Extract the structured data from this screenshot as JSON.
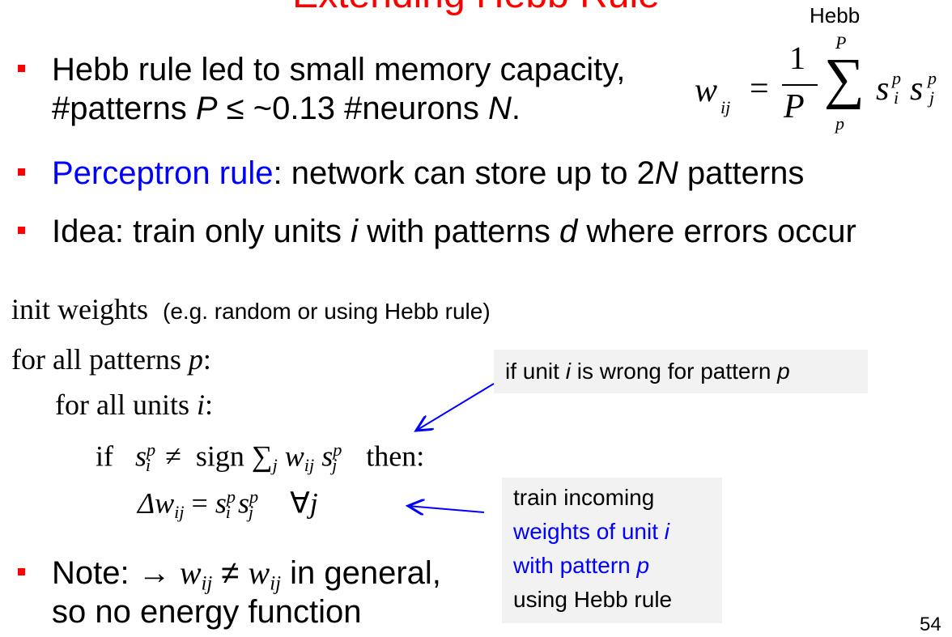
{
  "slide": {
    "title": "Extending Hebb Rule",
    "page_number": "54"
  },
  "hebb_formula": {
    "label": "Hebb",
    "lhs": "w",
    "lhs_sub": "ij",
    "equals": "=",
    "numerator": "1",
    "denominator": "P",
    "sum_upper": "P",
    "sum_lower": "p",
    "term1": "s",
    "term1_sup": "p",
    "term1_sub": "i",
    "term2": "s",
    "term2_sup": "p",
    "term2_sub": "j"
  },
  "bullets": {
    "b1_line1": "Hebb rule led to small memory capacity,",
    "b1_line2_a": "#patterns ",
    "b1_line2_P": "P",
    "b1_line2_b": " ≤ ~0.13 #neurons ",
    "b1_line2_N": "N",
    "b1_line2_c": ".",
    "b2_link": "Perceptron rule",
    "b2_a": ": network can store up to 2",
    "b2_N": "N",
    "b2_b": " patterns",
    "b3_a": "Idea: train only units ",
    "b3_i": "i",
    "b3_b": " with patterns ",
    "b3_d": "d",
    "b3_c": " where errors occur",
    "b4_a": "Note: → ",
    "b4_w1": "w",
    "b4_w1_sub": "ij",
    "b4_neq": " ≠ ",
    "b4_w2": "w",
    "b4_w2_sub": "ij",
    "b4_b": " in general,",
    "b4_line2": "so no energy function"
  },
  "algorithm": {
    "line1": "init weights",
    "line1_note": "(e.g. random or using Hebb rule)",
    "line2_a": "for all patterns ",
    "line2_p": "p",
    "line2_b": ":",
    "line3_a": "for all units ",
    "line3_i": "i",
    "line3_b": ":",
    "line4_if": "if",
    "line4_s": "s",
    "line4_s_sup": "p",
    "line4_s_sub": "i",
    "line4_neq": "≠",
    "line4_sign": "sign",
    "line4_sum": "∑",
    "line4_sum_sub": "j",
    "line4_w": "w",
    "line4_w_sub": "ij",
    "line4_s2": "s",
    "line4_s2_sup": "p",
    "line4_s2_sub": "j",
    "line4_then": "then:",
    "line5_delta": "Δw",
    "line5_sub": "ij",
    "line5_eq": "=",
    "line5_s1": "s",
    "line5_s1_sup": "p",
    "line5_s1_sub": "i",
    "line5_s2": "s",
    "line5_s2_sup": "p",
    "line5_s2_sub": "j",
    "line5_forall": "∀",
    "line5_j": "j"
  },
  "callouts": {
    "wrong_a": "if unit ",
    "wrong_i": "i",
    "wrong_b": " is wrong for pattern ",
    "wrong_p": "p",
    "train_line1": "train incoming",
    "train_line2_a": "weights of unit ",
    "train_line2_i": "i",
    "train_line3_a": "with pattern ",
    "train_line3_p": "p",
    "train_line4": "using Hebb rule"
  },
  "colors": {
    "title": "#ff0000",
    "bullet": "#ff0000",
    "highlight": "#0000ff",
    "callout_bg": "#f2f2f2",
    "arrow": "#0000ff"
  }
}
